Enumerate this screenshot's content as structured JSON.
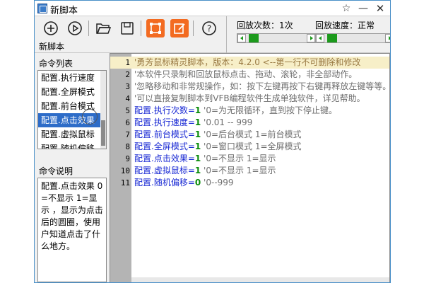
{
  "window": {
    "title": "新脚本"
  },
  "toolbar": {
    "buttons": [
      {
        "icon": "add-circle-icon",
        "glyph": "⊕"
      },
      {
        "icon": "play-circle-icon",
        "glyph": "▷"
      },
      {
        "icon": "folder-open-icon",
        "glyph": "📂"
      },
      {
        "icon": "save-icon",
        "glyph": "💾"
      },
      {
        "icon": "select-region-icon",
        "glyph": "⛶"
      },
      {
        "icon": "edit-icon",
        "glyph": "✎"
      },
      {
        "icon": "help-icon",
        "glyph": "?"
      }
    ],
    "script_name": "新脚本",
    "accent": "#f36b21"
  },
  "playback": {
    "count_label": "回放次数：1次",
    "speed_label": "回放速度：正常",
    "count_value": 0.05,
    "speed_value": 0.05,
    "slider_color": "#1c9a1c"
  },
  "commands": {
    "header": "命令列表",
    "items": [
      "配置.执行速度",
      "配置.全屏模式",
      "配置.前台模式",
      "配置.点击效果",
      "配置.虚拟鼠标",
      "配置.随机偏移"
    ],
    "selected_index": 3
  },
  "description": {
    "header": "命令说明",
    "text": "配置.点击效果 0=不显示 1=显示 ，显示为点击后的圆圈，使用户知道点击了什么地方。"
  },
  "editor": {
    "lines": [
      {
        "n": "1",
        "hl": true,
        "parts": [
          {
            "t": "'勇芳鼠标精灵脚本，版本：4.2.0  <--第一行不可删除和修改",
            "c": "hl-cmt"
          }
        ]
      },
      {
        "n": "2",
        "parts": [
          {
            "t": "'本软件只录制和回放鼠标点击、拖动、滚轮，非全部动作。",
            "c": "cmt"
          }
        ]
      },
      {
        "n": "3",
        "parts": [
          {
            "t": "'忽略移动和非常规操作，如：按下左键再按下右键再释放左键等等。",
            "c": "cmt"
          }
        ]
      },
      {
        "n": "4",
        "parts": [
          {
            "t": "'可以直接复制脚本到VFB编程软件生成单独软件，详见帮助。",
            "c": "cmt"
          }
        ]
      },
      {
        "n": "5",
        "parts": [
          {
            "t": "配置.执行次数=",
            "c": "kw"
          },
          {
            "t": "1",
            "c": "num"
          },
          {
            "t": " '0=为无限循环，直到按下停止键。",
            "c": "cmt"
          }
        ]
      },
      {
        "n": "6",
        "parts": [
          {
            "t": "配置.执行速度=",
            "c": "kw"
          },
          {
            "t": "1",
            "c": "num"
          },
          {
            "t": " '0.01 -- 999",
            "c": "cmt"
          }
        ]
      },
      {
        "n": "7",
        "parts": [
          {
            "t": "配置.前台模式=",
            "c": "kw"
          },
          {
            "t": "1",
            "c": "num"
          },
          {
            "t": " '0=后台模式 1=前台模式",
            "c": "cmt"
          }
        ]
      },
      {
        "n": "8",
        "parts": [
          {
            "t": "配置.全屏模式=",
            "c": "kw"
          },
          {
            "t": "1",
            "c": "num"
          },
          {
            "t": " '0=窗口模式 1=全屏模式",
            "c": "cmt"
          }
        ]
      },
      {
        "n": "9",
        "parts": [
          {
            "t": "配置.点击效果=",
            "c": "kw"
          },
          {
            "t": "1",
            "c": "num"
          },
          {
            "t": " '0=不显示 1=显示",
            "c": "cmt"
          }
        ]
      },
      {
        "n": "10",
        "parts": [
          {
            "t": "配置.虚拟鼠标=",
            "c": "kw"
          },
          {
            "t": "1",
            "c": "num"
          },
          {
            "t": " '0=不显示 1=显示",
            "c": "cmt"
          }
        ]
      },
      {
        "n": "11",
        "parts": [
          {
            "t": "配置.随机偏移=",
            "c": "kw"
          },
          {
            "t": "0",
            "c": "num"
          },
          {
            "t": " '0--999",
            "c": "cmt"
          }
        ]
      }
    ]
  }
}
